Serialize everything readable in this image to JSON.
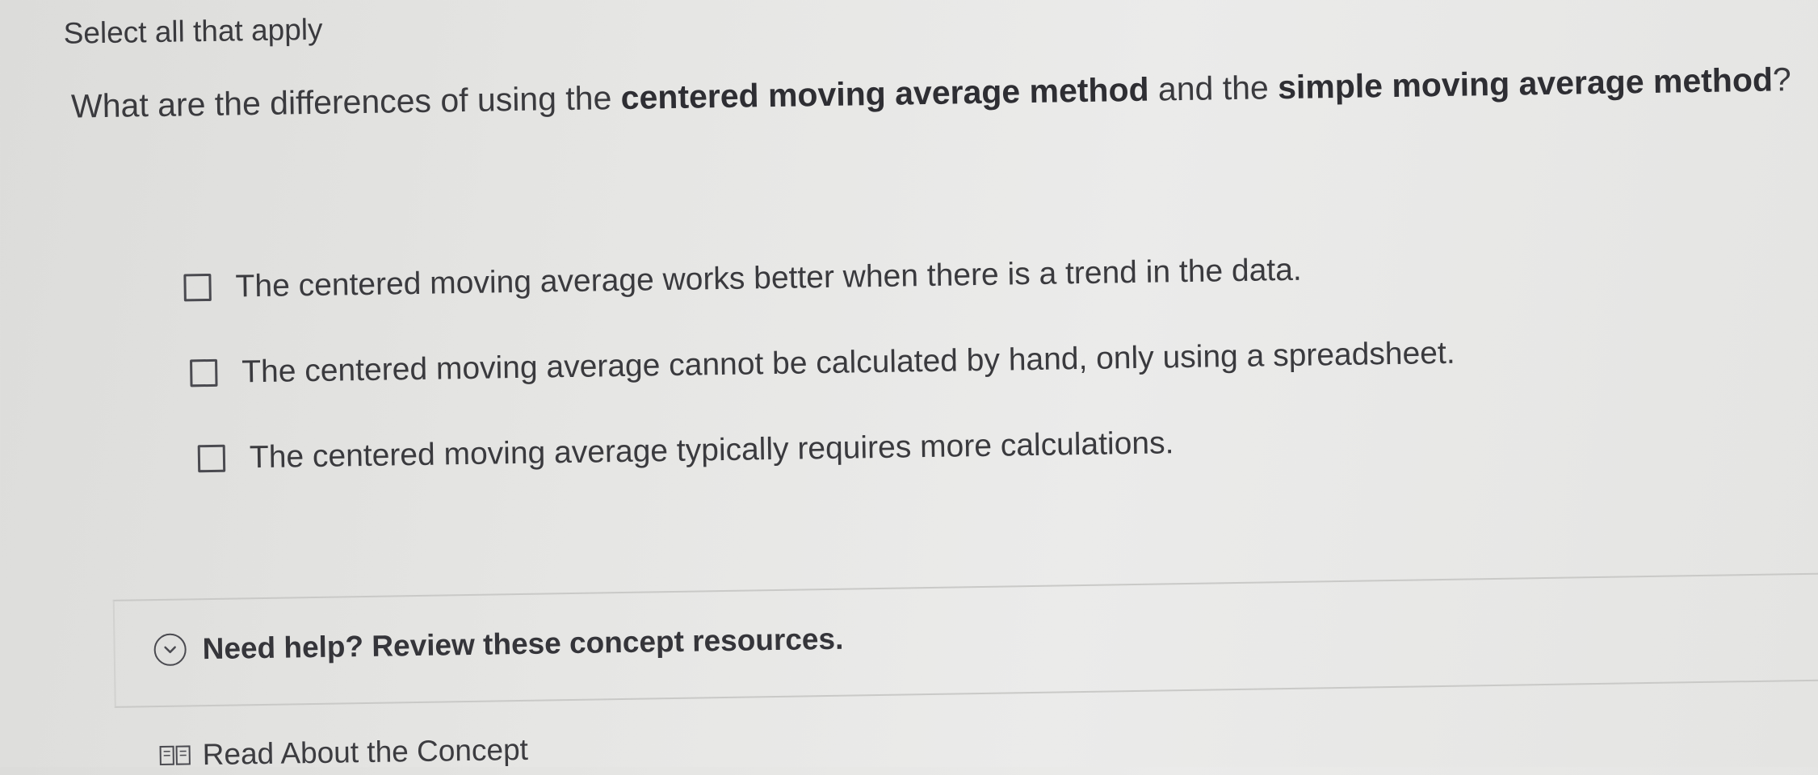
{
  "instruction": "Select all that apply",
  "question": {
    "prefix": "What are the differences of using the ",
    "term1": "centered moving average method",
    "middle": " and the ",
    "term2": "simple moving average method",
    "suffix": "?"
  },
  "options": [
    {
      "label": "The centered moving average works better when there is a trend in the data.",
      "checked": false
    },
    {
      "label": "The centered moving average cannot be calculated by hand, only using a spreadsheet.",
      "checked": false
    },
    {
      "label": "The centered moving average typically requires more calculations.",
      "checked": false
    }
  ],
  "help": {
    "toggle_label": "Need help? Review these concept resources.",
    "icon": "chevron-down-circle-icon"
  },
  "resources": {
    "read_label": "Read About the Concept",
    "icon": "book-icon"
  }
}
